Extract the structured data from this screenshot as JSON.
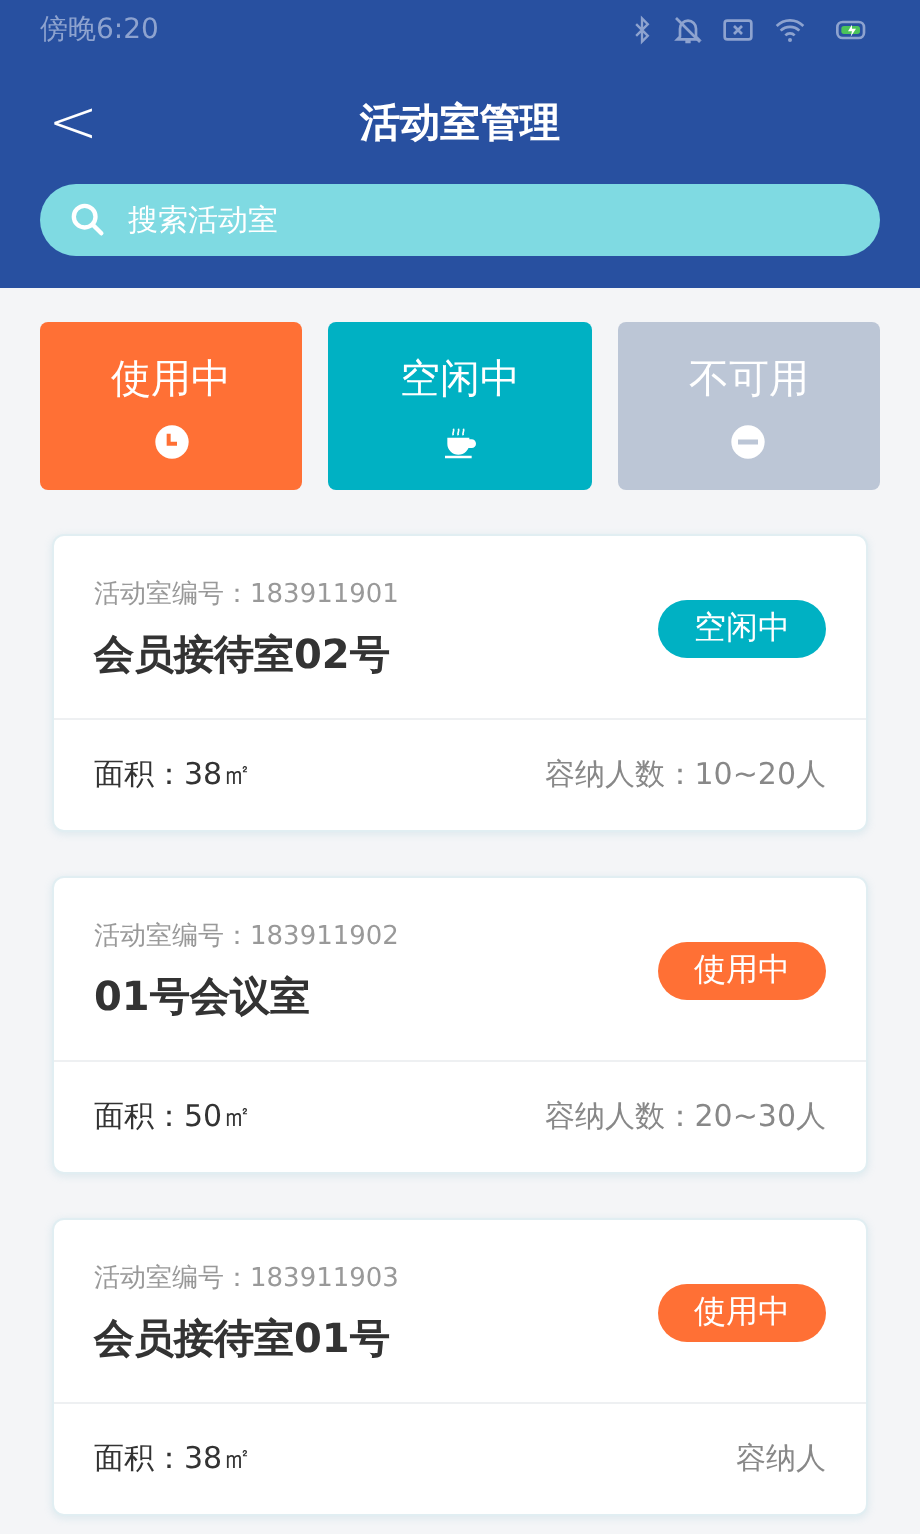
{
  "status_bar": {
    "time": "傍晚6:20"
  },
  "header": {
    "back": "<",
    "title": "活动室管理"
  },
  "search": {
    "placeholder": "搜索活动室"
  },
  "filters": [
    {
      "label": "使用中",
      "kind": "clock",
      "color": "#ff7035"
    },
    {
      "label": "空闲中",
      "kind": "cup",
      "color": "#00b1c3"
    },
    {
      "label": "不可用",
      "kind": "minus",
      "color": "#bcc6d6"
    }
  ],
  "rooms": [
    {
      "number": "活动室编号：183911901",
      "name": "会员接待室02号",
      "status": "空闲中",
      "color": "#00b1c3",
      "area": "面积：38㎡",
      "capacity": "容纳人数：10~20人"
    },
    {
      "number": "活动室编号：183911902",
      "name": "01号会议室",
      "status": "使用中",
      "color": "#ff7035",
      "area": "面积：50㎡",
      "capacity": "容纳人数：20~30人"
    },
    {
      "number": "活动室编号：183911903",
      "name": "会员接待室01号",
      "status": "使用中",
      "color": "#ff7035",
      "area": "面积：38㎡",
      "capacity": "容纳人"
    }
  ]
}
